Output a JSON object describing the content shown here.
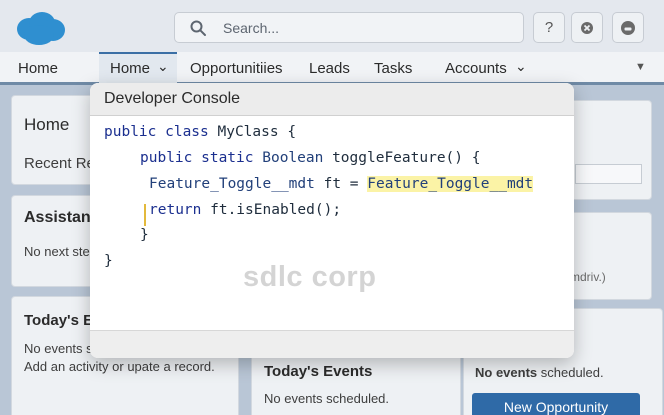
{
  "header": {
    "search_placeholder": "Search...",
    "help_label": "?"
  },
  "nav": {
    "app_name": "Home",
    "tabs": [
      {
        "label": "Home"
      },
      {
        "label": "Opportunitiies"
      },
      {
        "label": "Leads"
      },
      {
        "label": "Tasks"
      },
      {
        "label": "Accounts"
      }
    ]
  },
  "background": {
    "home_card": {
      "title": "Home",
      "recent": "Recent Re"
    },
    "assistant_card": {
      "title": "Assistant",
      "text": "No next ste"
    },
    "events_left": {
      "title": "Today's Ev",
      "line1": "No events s",
      "line2": "Add an activity or upate a record."
    },
    "events_mid": {
      "title": "Today's Events",
      "line1": "No events scheduled."
    },
    "right_card": {
      "fragment": "mdriv.)",
      "line1_bold": "No events",
      "line1_rest": " scheduled."
    },
    "new_opportunity_button": "New Opportunity"
  },
  "modal": {
    "title": "Developer Console",
    "code": {
      "l1": {
        "kw": "public class",
        "rest": " MyClass {"
      },
      "l2": {
        "kw": "public static",
        "type": " Boolean",
        "rest": " toggleFeature() {"
      },
      "l3": {
        "a": "Feature_Toggle__mdt",
        "b": " ft = ",
        "hl": "Feature_Toggle__mdt"
      },
      "l4": {
        "a": "return",
        "b": " ft.isEnabled();"
      },
      "l5": "}",
      "l6": "}"
    },
    "watermark": "sdlc corp"
  }
}
